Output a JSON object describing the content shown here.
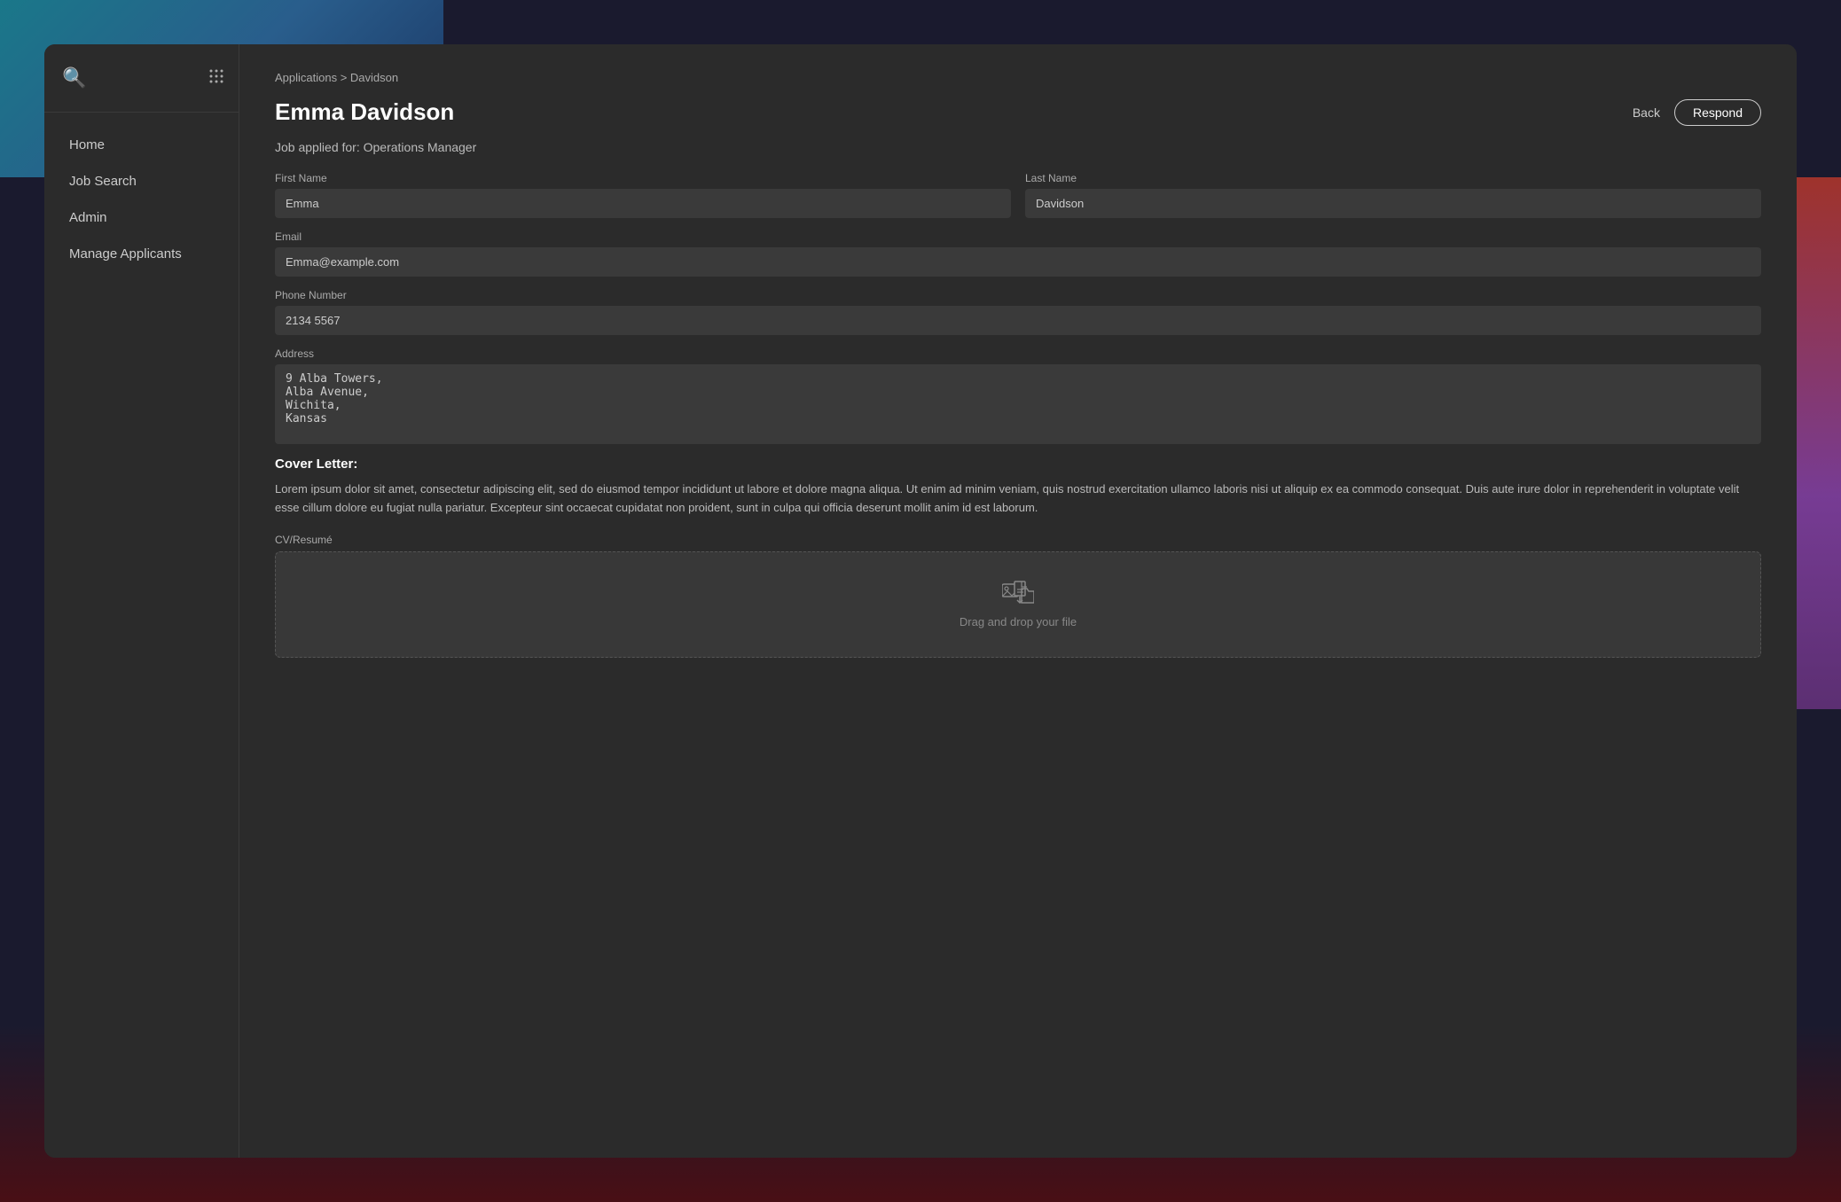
{
  "background": {
    "color": "#1a1a2e"
  },
  "sidebar": {
    "logo": "🔍",
    "grid_icon": "⠿",
    "nav_items": [
      {
        "id": "home",
        "label": "Home"
      },
      {
        "id": "job-search",
        "label": "Job Search"
      },
      {
        "id": "admin",
        "label": "Admin"
      },
      {
        "id": "manage-applicants",
        "label": "Manage Applicants"
      }
    ]
  },
  "breadcrumb": {
    "text": "Applications > Davidson"
  },
  "header": {
    "title": "Emma Davidson",
    "back_label": "Back",
    "respond_label": "Respond"
  },
  "job_info": {
    "label": "Job applied for: Operations Manager"
  },
  "form": {
    "first_name_label": "First Name",
    "first_name_value": "Emma",
    "last_name_label": "Last Name",
    "last_name_value": "Davidson",
    "email_label": "Email",
    "email_value": "Emma@example.com",
    "phone_label": "Phone Number",
    "phone_value": "2134 5567",
    "address_label": "Address",
    "address_value": "9 Alba Towers,\nAlba Avenue,\nWichita,\nKansas"
  },
  "cover_letter": {
    "section_title": "Cover Letter:",
    "text": "Lorem ipsum dolor sit amet, consectetur adipiscing elit, sed do eiusmod tempor incididunt ut labore et dolore magna aliqua. Ut enim ad minim veniam, quis nostrud exercitation ullamco laboris nisi ut aliquip ex ea commodo consequat. Duis aute irure dolor in reprehenderit in voluptate velit esse cillum dolore eu fugiat nulla pariatur. Excepteur sint occaecat cupidatat non proident, sunt in culpa qui officia deserunt mollit anim id est laborum."
  },
  "cv": {
    "label": "CV/Resumé",
    "drop_text": "Drag and drop your file"
  }
}
